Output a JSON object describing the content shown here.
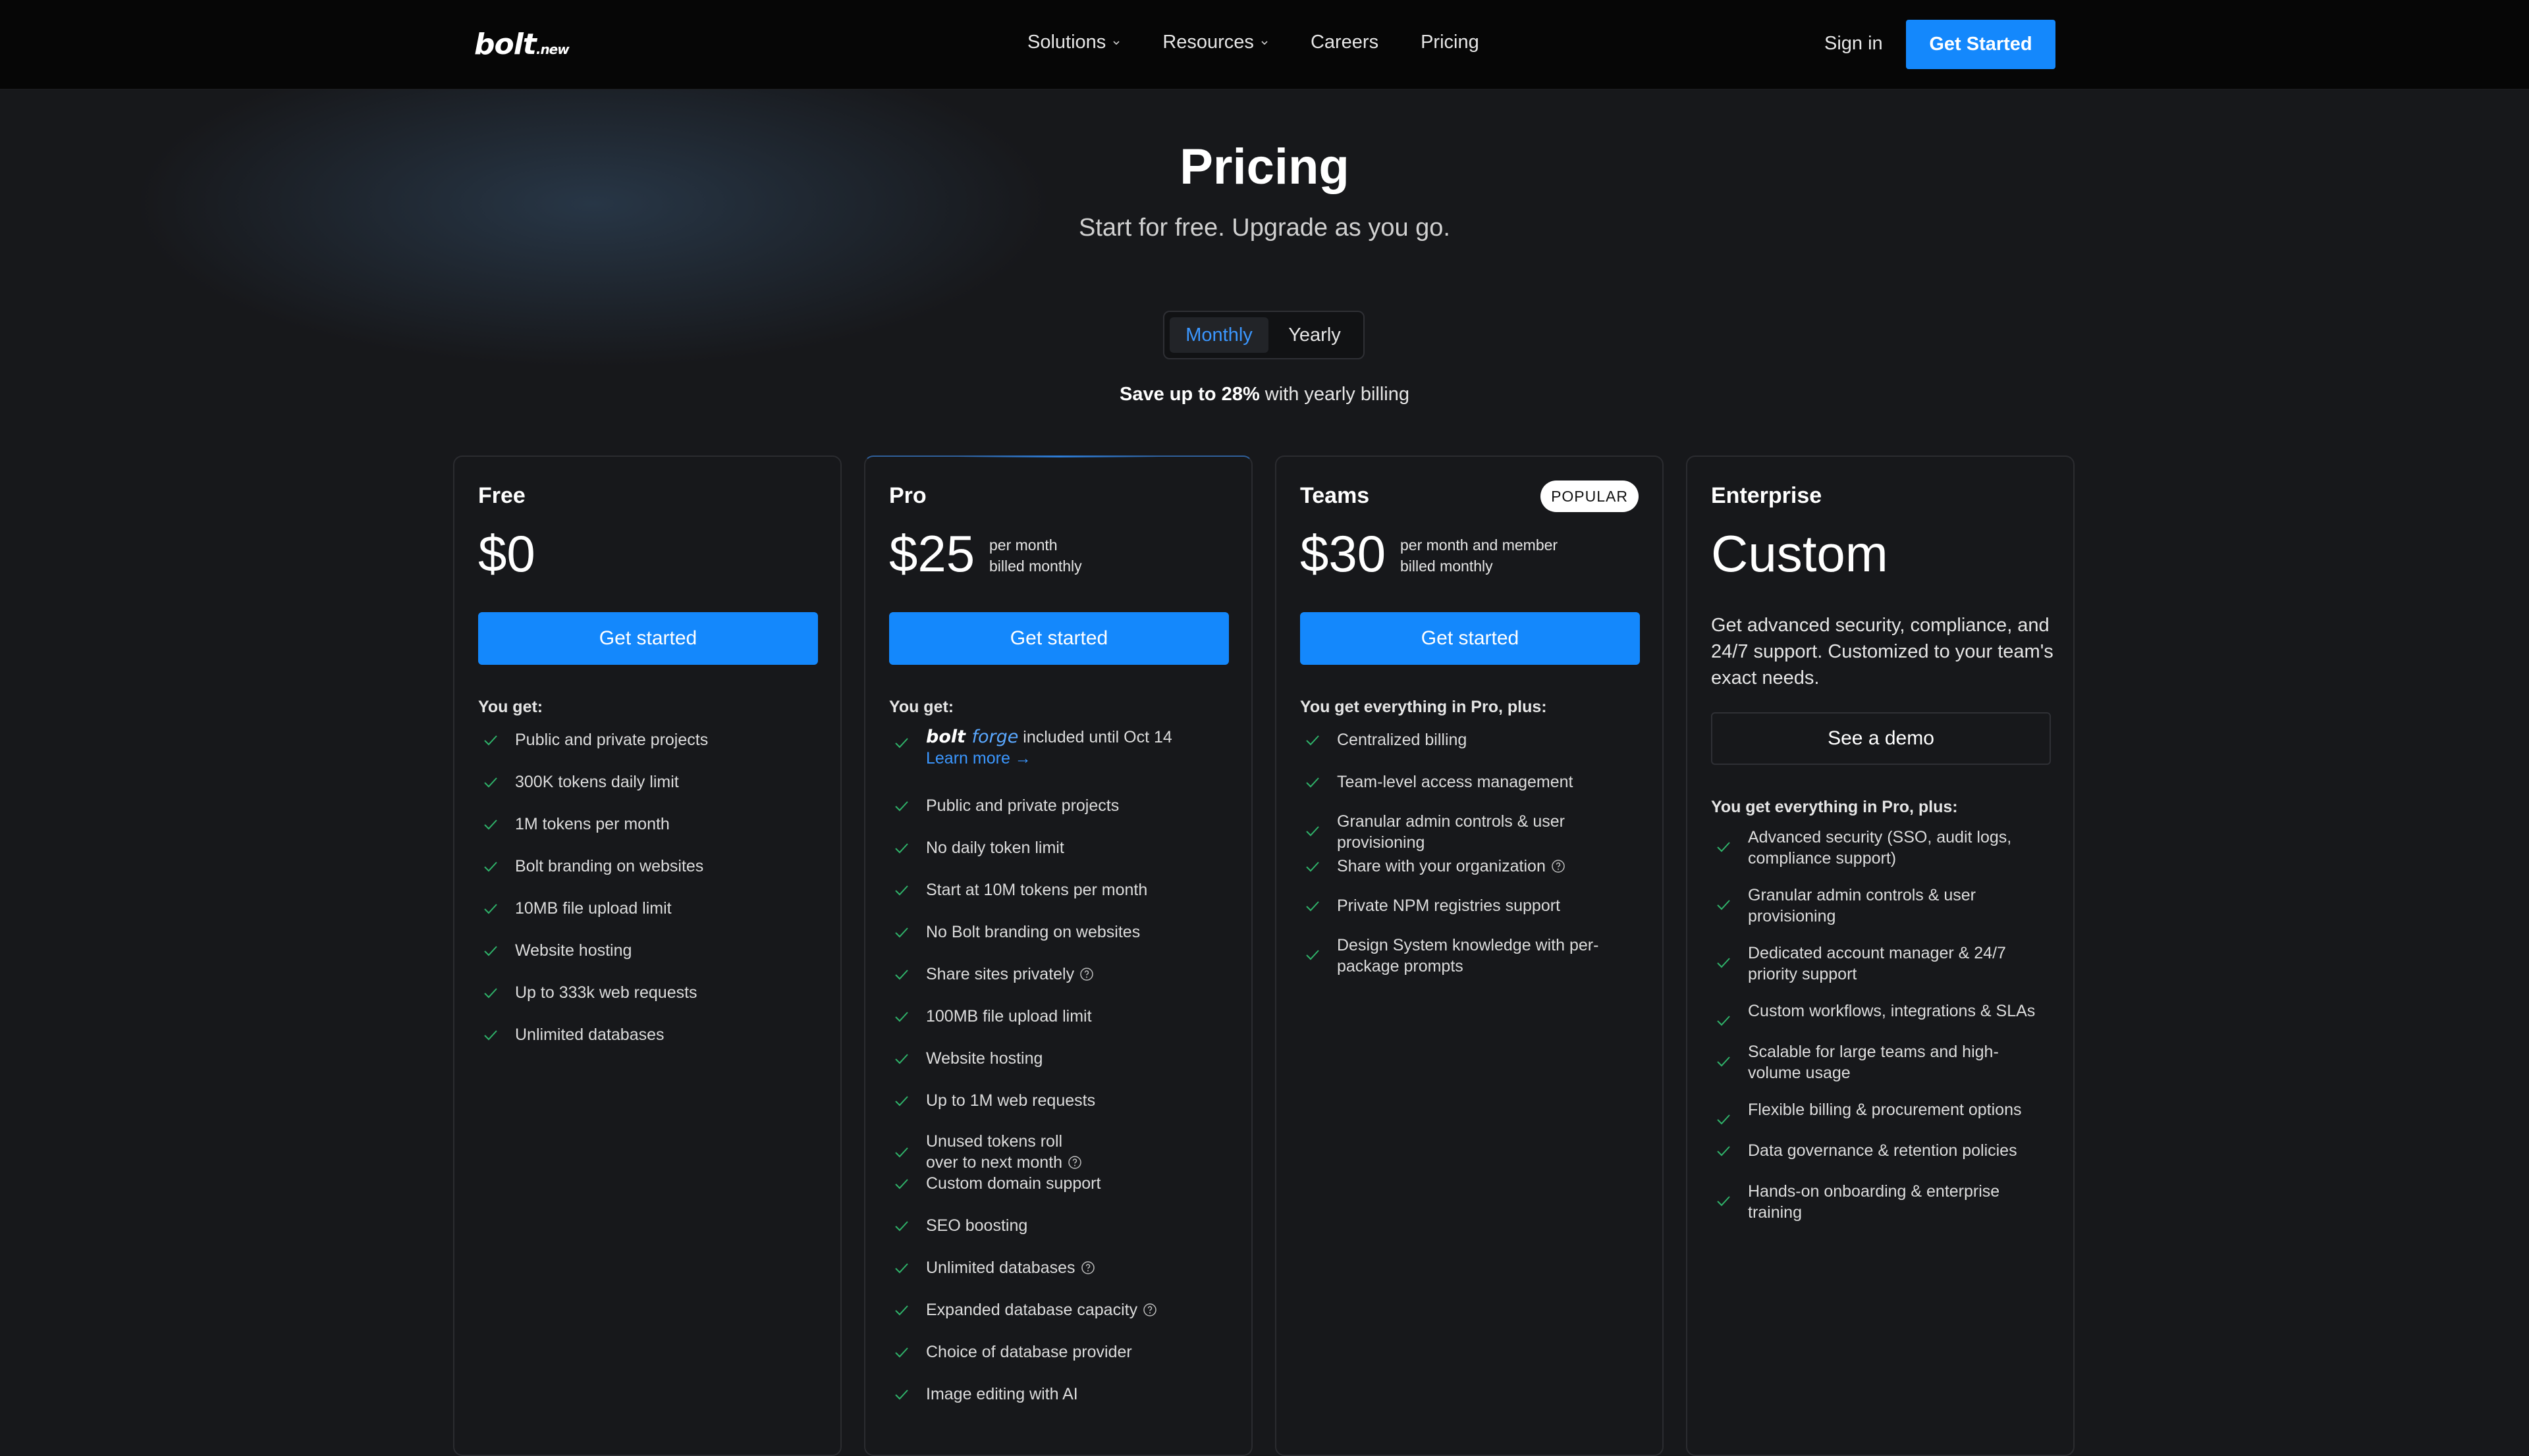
{
  "nav": {
    "logo": "bolt",
    "logo_suffix": ".new",
    "links": [
      "Solutions",
      "Resources",
      "Careers",
      "Pricing"
    ],
    "sign_in": "Sign in",
    "cta": "Get Started"
  },
  "hero": {
    "title": "Pricing",
    "subtitle": "Start for free. Upgrade as you go.",
    "toggle": {
      "monthly": "Monthly",
      "yearly": "Yearly",
      "selected": "Monthly"
    },
    "save_bold": "Save up to 28%",
    "save_rest": " with yearly billing"
  },
  "colors": {
    "accent": "#1488fc",
    "background": "#17181b",
    "check": "#2fb36a"
  },
  "plans": [
    {
      "name": "Free",
      "price": "$0",
      "cta": "Get started",
      "features_heading": "You get:",
      "features": [
        "Public and private projects",
        "300K tokens daily limit",
        "1M tokens per month",
        "Bolt branding on websites",
        "10MB file upload limit",
        "Website hosting",
        "Up to 333k web requests",
        "Unlimited databases"
      ]
    },
    {
      "name": "Pro",
      "price": "$25",
      "price_note_1": "per month",
      "price_note_2": "billed monthly",
      "cta": "Get started",
      "features_heading": "You get:",
      "forge": {
        "logo_a": "bolt",
        "logo_b": "forge",
        "text": " included until Oct 14",
        "link": "Learn more →"
      },
      "features": [
        "Public and private projects",
        "No daily token limit",
        "Start at 10M tokens per month",
        "No Bolt branding on websites",
        "Share sites privately",
        "100MB file upload limit",
        "Website hosting",
        "Up to 1M web requests",
        "Unused tokens roll",
        "over to next month",
        "Custom domain support",
        "SEO boosting",
        "Unlimited databases",
        "Expanded database capacity",
        "Choice of database provider",
        "Image editing with AI"
      ]
    },
    {
      "name": "Teams",
      "badge": "POPULAR",
      "price": "$30",
      "price_note_1": "per month and member",
      "price_note_2": "billed monthly",
      "cta": "Get started",
      "features_heading": "You get everything in Pro, plus:",
      "features": [
        "Centralized billing",
        "Team-level access management",
        "Granular admin controls & user provisioning",
        "Share with your organization",
        "Private NPM registries support",
        "Design System knowledge with per-package prompts"
      ]
    },
    {
      "name": "Enterprise",
      "price": "Custom",
      "description": "Get advanced security, compliance, and 24/7 support. Customized to your team's exact needs.",
      "cta": "See a demo",
      "features_heading": "You get everything in Pro, plus:",
      "features": [
        "Advanced security (SSO, audit logs, compliance support)",
        "Granular admin controls & user provisioning",
        "Dedicated account manager & 24/7 priority support",
        "Custom workflows, integrations & SLAs",
        "Scalable for large teams and high-volume usage",
        "Flexible billing & procurement options",
        "Data governance & retention policies",
        "Hands-on onboarding & enterprise training"
      ]
    }
  ]
}
